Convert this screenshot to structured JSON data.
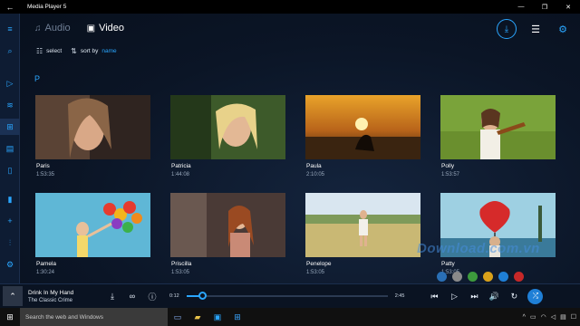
{
  "window": {
    "title": "Media Player 5",
    "back_glyph": "←",
    "minimize_glyph": "—",
    "maximize_glyph": "❐",
    "close_glyph": "✕"
  },
  "rail": {
    "items": [
      {
        "name": "menu-icon",
        "glyph": "≡"
      },
      {
        "name": "search-icon",
        "glyph": "⌕"
      },
      {
        "name": "play-icon",
        "glyph": "▷"
      },
      {
        "name": "playlist-icon",
        "glyph": "≋"
      },
      {
        "name": "grid-icon",
        "glyph": "⊞"
      },
      {
        "name": "album-icon",
        "glyph": "▤"
      },
      {
        "name": "device-icon",
        "glyph": "▯"
      },
      {
        "name": "tablet-icon",
        "glyph": "▮"
      },
      {
        "name": "add-icon",
        "glyph": "+"
      },
      {
        "name": "equalizer-icon",
        "glyph": "⫶"
      },
      {
        "name": "settings-icon",
        "glyph": "⚙"
      }
    ]
  },
  "tabs": [
    {
      "label": "Audio",
      "glyph": "♫"
    },
    {
      "label": "Video",
      "glyph": "▣"
    }
  ],
  "top_actions": {
    "download_glyph": "⤓",
    "list_glyph": "☰",
    "settings_glyph": "⚙"
  },
  "subbar": {
    "select_label": "select",
    "sort_label": "sort by",
    "sort_value": "name",
    "select_glyph": "☷",
    "sort_glyph": "⇅"
  },
  "group_letter": "P",
  "videos": [
    {
      "name": "Paris",
      "duration": "1:53:35"
    },
    {
      "name": "Patricia",
      "duration": "1:44:08"
    },
    {
      "name": "Paula",
      "duration": "2:10:05"
    },
    {
      "name": "Polly",
      "duration": "1:53:57"
    },
    {
      "name": "Pamela",
      "duration": "1:30:24"
    },
    {
      "name": "Priscilla",
      "duration": "1:53:05"
    },
    {
      "name": "Penelope",
      "duration": "1:53:05"
    },
    {
      "name": "Patty",
      "duration": "1:53:05"
    }
  ],
  "watermark": "Download.com.vn",
  "dot_colors": [
    "#2a6fb5",
    "#8a8a8a",
    "#3d9a3d",
    "#d9a11a",
    "#1f7fd6",
    "#c62828"
  ],
  "player": {
    "expand_glyph": "⌃",
    "track_title": "Drink In My Hand",
    "artist": "The Classic Crime",
    "current_time": "0:12",
    "total_time": "2:45",
    "progress": 0.08,
    "download_glyph": "⤓",
    "loop_glyph": "∞",
    "info_glyph": "ⓘ",
    "prev_glyph": "⏮",
    "play_glyph": "▷",
    "next_glyph": "⏭",
    "volume_glyph": "🔊",
    "repeat_glyph": "↻",
    "shuffle_glyph": "⤮"
  },
  "taskbar": {
    "search_placeholder": "Search the web and Windows",
    "start_glyph": "⊞",
    "time_glyph": "▭"
  },
  "colors": {
    "accent": "#2aa6ff",
    "background": "#0b1526"
  }
}
